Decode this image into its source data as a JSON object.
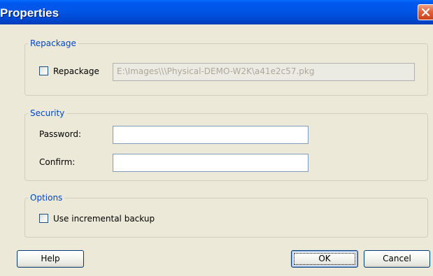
{
  "window": {
    "title": "Properties"
  },
  "repackage_group": {
    "title": "Repackage",
    "checkbox_label": "Repackage",
    "checked": false,
    "path_value": "E:\\Images\\\\\\Physical-DEMO-W2K\\a41e2c57.pkg"
  },
  "security_group": {
    "title": "Security",
    "password_label": "Password:",
    "password_value": "",
    "confirm_label": "Confirm:",
    "confirm_value": ""
  },
  "options_group": {
    "title": "Options",
    "incremental_label": "Use incremental backup",
    "checked": false
  },
  "buttons": {
    "help": "Help",
    "ok": "OK",
    "cancel": "Cancel"
  },
  "icons": {
    "close": "close-icon"
  },
  "colors": {
    "titlebar": "#0055E5",
    "dialog_bg": "#ECE9D8",
    "group_title": "#0046D5",
    "close_button": "#E2623C"
  }
}
